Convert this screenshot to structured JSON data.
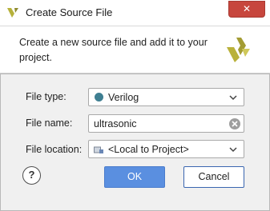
{
  "window": {
    "title": "Create Source File",
    "close_symbol": "✕"
  },
  "banner": {
    "description": "Create a new source file and add it to your project."
  },
  "form": {
    "file_type": {
      "label": "File type:",
      "value": "Verilog"
    },
    "file_name": {
      "label": "File name:",
      "value": "ultrasonic"
    },
    "file_location": {
      "label": "File location:",
      "value": "<Local to Project>"
    }
  },
  "buttons": {
    "help": "?",
    "ok": "OK",
    "cancel": "Cancel"
  },
  "colors": {
    "accent": "#5a8fe0",
    "close": "#c7463d",
    "verilog_dot": "#3f7f92",
    "logo": "#b9b13a"
  }
}
